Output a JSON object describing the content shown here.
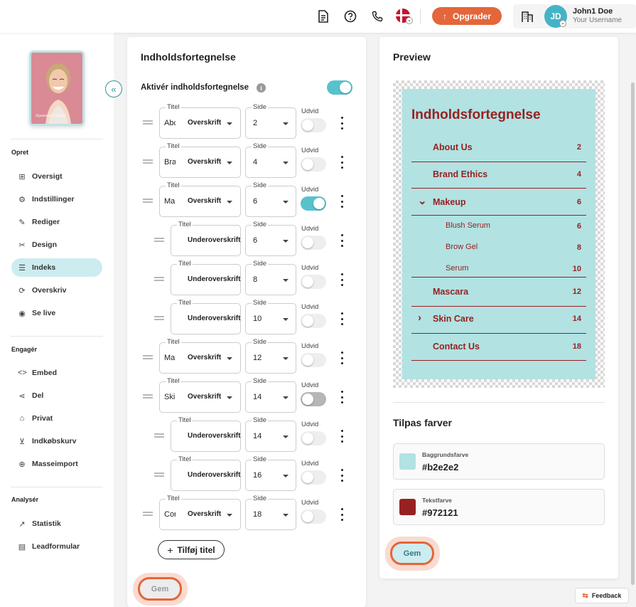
{
  "header": {
    "upgrade_label": "Opgrader",
    "avatar_initials": "JD",
    "user_name": "John1 Doe",
    "user_sub": "Your Username"
  },
  "sidebar": {
    "cover_text": "Hjemmets Styler",
    "sections": [
      {
        "title": "Opret",
        "items": [
          {
            "label": "Oversigt",
            "icon": "layout-icon"
          },
          {
            "label": "Indstillinger",
            "icon": "gear-icon"
          },
          {
            "label": "Rediger",
            "icon": "pencil-icon"
          },
          {
            "label": "Design",
            "icon": "tools-icon"
          },
          {
            "label": "Indeks",
            "icon": "list-icon",
            "active": true
          },
          {
            "label": "Overskriv",
            "icon": "refresh-icon"
          },
          {
            "label": "Se live",
            "icon": "eye-icon"
          }
        ]
      },
      {
        "title": "Engagér",
        "items": [
          {
            "label": "Embed",
            "icon": "code-icon"
          },
          {
            "label": "Del",
            "icon": "share-icon"
          },
          {
            "label": "Privat",
            "icon": "lock-icon"
          },
          {
            "label": "Indkøbskurv",
            "icon": "cart-icon"
          },
          {
            "label": "Masseimport",
            "icon": "import-icon"
          }
        ]
      },
      {
        "title": "Analysér",
        "items": [
          {
            "label": "Statistik",
            "icon": "chart-icon"
          },
          {
            "label": "Leadformular",
            "icon": "form-icon"
          }
        ]
      }
    ]
  },
  "toc": {
    "title": "Indholdsfortegnelse",
    "activate_label": "Aktivér indholdsfortegnelse",
    "activate_on": true,
    "field_labels": {
      "title": "Titel",
      "page": "Side",
      "expand": "Udvid"
    },
    "rows": [
      {
        "title": "Abc",
        "type": "Overskrift",
        "page": "2",
        "sub": false,
        "expand": false
      },
      {
        "title": "Bra",
        "type": "Overskrift",
        "page": "4",
        "sub": false,
        "expand": false
      },
      {
        "title": "Ma",
        "type": "Overskrift",
        "page": "6",
        "sub": false,
        "expand": true
      },
      {
        "title": "",
        "type": "Underoverskrift",
        "page": "6",
        "sub": true,
        "expand": false
      },
      {
        "title": "",
        "type": "Underoverskrift",
        "page": "8",
        "sub": true,
        "expand": false
      },
      {
        "title": "",
        "type": "Underoverskrift",
        "page": "10",
        "sub": true,
        "expand": false
      },
      {
        "title": "Ma",
        "type": "Overskrift",
        "page": "12",
        "sub": false,
        "expand": false
      },
      {
        "title": "Skin",
        "type": "Overskrift",
        "page": "14",
        "sub": false,
        "expand": false,
        "dark": true
      },
      {
        "title": "",
        "type": "Underoverskrift",
        "page": "14",
        "sub": true,
        "expand": false
      },
      {
        "title": "",
        "type": "Underoverskrift",
        "page": "16",
        "sub": true,
        "expand": false
      },
      {
        "title": "Con",
        "type": "Overskrift",
        "page": "18",
        "sub": false,
        "expand": false
      }
    ],
    "add_label": "Tilføj titel",
    "save_label": "Gem"
  },
  "preview": {
    "title": "Preview",
    "toc_heading": "Indholdsfortegnelse",
    "entries": [
      {
        "label": "About Us",
        "page": "2",
        "level": 1
      },
      {
        "label": "Brand Ethics",
        "page": "4",
        "level": 1
      },
      {
        "label": "Makeup",
        "page": "6",
        "level": 1,
        "arrow": "down"
      },
      {
        "label": "Blush Serum",
        "page": "6",
        "level": 2
      },
      {
        "label": "Brow Gel",
        "page": "8",
        "level": 2
      },
      {
        "label": "Serum",
        "page": "10",
        "level": 2
      },
      {
        "label": "Mascara",
        "page": "12",
        "level": 1
      },
      {
        "label": "Skin Care",
        "page": "14",
        "level": 1,
        "arrow": "right"
      },
      {
        "label": "Contact Us",
        "page": "18",
        "level": 1
      }
    ]
  },
  "colors": {
    "title": "Tilpas farver",
    "background_label": "Baggrundsfarve",
    "background_value": "#b2e2e2",
    "text_label": "Tekstfarve",
    "text_value": "#972121",
    "save_label": "Gem"
  },
  "feedback_label": "Feedback",
  "accent": "#e4663a",
  "teal": "#57c2cc"
}
